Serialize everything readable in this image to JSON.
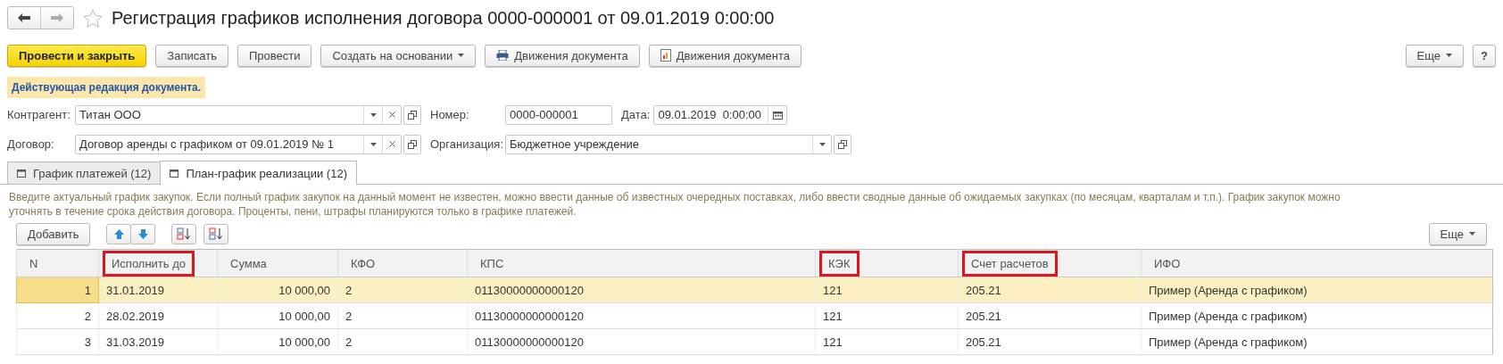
{
  "window": {
    "title": "Регистрация графиков исполнения договора 0000-000001 от 09.01.2019 0:00:00"
  },
  "toolbar": {
    "buttons": [
      {
        "label": "Провести и закрыть",
        "kind": "primary"
      },
      {
        "label": "Записать",
        "kind": "plain"
      },
      {
        "label": "Провести",
        "kind": "plain"
      },
      {
        "label": "Создать на основании",
        "kind": "dropdown"
      },
      {
        "label": "Движения документа",
        "kind": "print"
      },
      {
        "label": "Движения документа",
        "kind": "report"
      }
    ],
    "more": "Еще",
    "help": "?"
  },
  "notice": "Действующая редакция документа.",
  "fields": {
    "counterparty": {
      "label": "Контрагент:",
      "value": "Титан ООО"
    },
    "number": {
      "label": "Номер:",
      "value": "0000-000001"
    },
    "date": {
      "label": "Дата:",
      "value": "09.01.2019  0:00:00"
    },
    "contract": {
      "label": "Договор:",
      "value": "Договор аренды с графиком от 09.01.2019 № 1"
    },
    "organization": {
      "label": "Организация:",
      "value": "Бюджетное учреждение"
    }
  },
  "tabs": [
    {
      "label": "График платежей (12)",
      "selected": false
    },
    {
      "label": "План-график реализации (12)",
      "selected": true
    }
  ],
  "hint": "Введите актуальный график закупок. Если полный график закупок на данный момент не известен, можно ввести данные об известных очередных поставках, либо ввести сводные данные об ожидаемых закупках (по месяцам, кварталам и т.п.). График закупок можно уточнять в течение срока действия договора. Проценты, пени, штрафы планируются только в графике платежей.",
  "table_toolbar": {
    "add": "Добавить",
    "more": "Еще"
  },
  "table": {
    "columns": [
      {
        "label": "N",
        "highlighted": false
      },
      {
        "label": "Исполнить до",
        "highlighted": true
      },
      {
        "label": "Сумма",
        "highlighted": false
      },
      {
        "label": "КФО",
        "highlighted": false
      },
      {
        "label": "КПС",
        "highlighted": false
      },
      {
        "label": "КЭК",
        "highlighted": true
      },
      {
        "label": "Счет расчетов",
        "highlighted": true
      },
      {
        "label": "ИФО",
        "highlighted": false
      }
    ],
    "rows": [
      {
        "selected": true,
        "cells": [
          "1",
          "31.01.2019",
          "10 000,00",
          "2",
          "01130000000000120",
          "121",
          "205.21",
          "Пример (Аренда с графиком)"
        ]
      },
      {
        "selected": false,
        "cells": [
          "2",
          "28.02.2019",
          "10 000,00",
          "2",
          "01130000000000120",
          "121",
          "205.21",
          "Пример (Аренда с графиком)"
        ]
      },
      {
        "selected": false,
        "cells": [
          "3",
          "31.03.2019",
          "10 000,00",
          "2",
          "01130000000000120",
          "121",
          "205.21",
          "Пример (Аренда с графиком)"
        ]
      }
    ]
  }
}
